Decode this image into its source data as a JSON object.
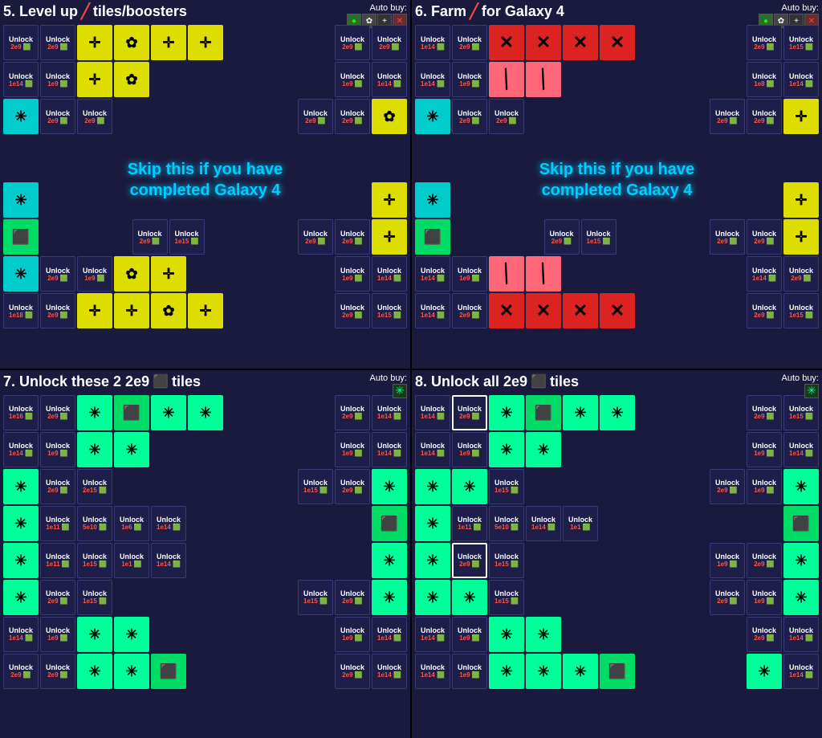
{
  "quadrants": [
    {
      "id": "q1",
      "title": "5. Level up",
      "title2": "tiles/boosters",
      "autobuy_label": "Auto buy:",
      "skip_message": "Skip this if you have\ncompleted Galaxy 4",
      "has_skip": true
    },
    {
      "id": "q2",
      "title": "6. Farm",
      "title2": "for Galaxy 4",
      "autobuy_label": "Auto buy:",
      "skip_message": "Skip this if you have\ncompleted Galaxy 4",
      "has_skip": true
    },
    {
      "id": "q3",
      "title": "7. Unlock these 2 2e9",
      "title2": "tiles",
      "autobuy_label": "Auto buy:",
      "has_skip": false
    },
    {
      "id": "q4",
      "title": "8. Unlock all 2e9",
      "title2": "tiles",
      "autobuy_label": "Auto buy:",
      "has_skip": false
    }
  ],
  "icons": {
    "move": "✛",
    "gear": "✿",
    "cube": "⬛",
    "star": "✳",
    "x_mark": "✕",
    "slash": "/",
    "plus": "+",
    "cross": "✕"
  }
}
